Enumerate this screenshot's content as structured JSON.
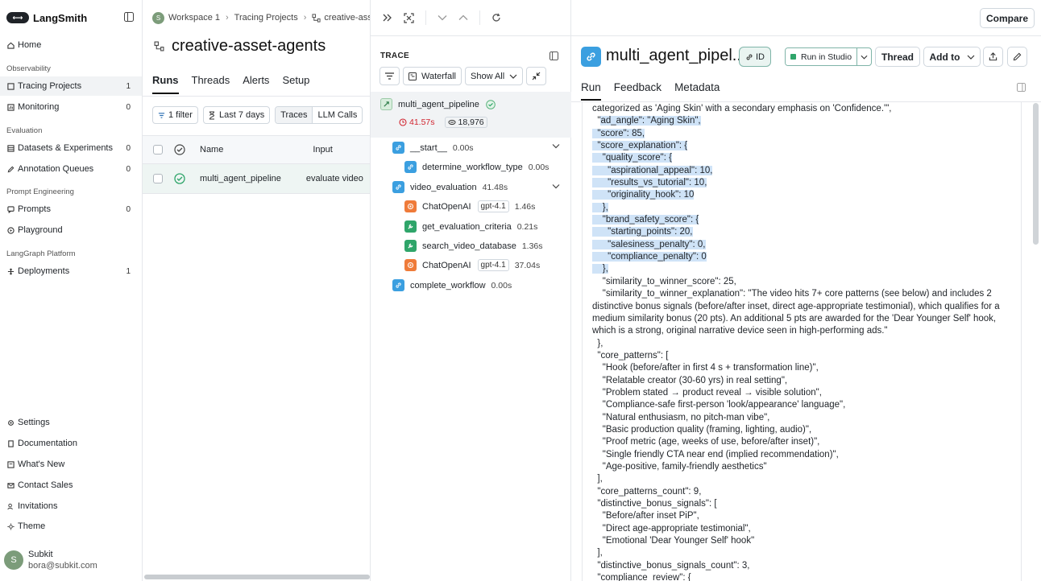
{
  "app": {
    "name": "LangSmith"
  },
  "sidebar": {
    "top_items": [
      {
        "label": "Home",
        "icon": "home-icon"
      }
    ],
    "sections": [
      {
        "title": "Observability",
        "items": [
          {
            "label": "Tracing Projects",
            "count": "1"
          },
          {
            "label": "Monitoring",
            "count": "0"
          }
        ]
      },
      {
        "title": "Evaluation",
        "items": [
          {
            "label": "Datasets & Experiments",
            "count": "0"
          },
          {
            "label": "Annotation Queues",
            "count": "0"
          }
        ]
      },
      {
        "title": "Prompt Engineering",
        "items": [
          {
            "label": "Prompts",
            "count": "0"
          },
          {
            "label": "Playground",
            "count": ""
          }
        ]
      },
      {
        "title": "LangGraph Platform",
        "items": [
          {
            "label": "Deployments",
            "count": "1"
          }
        ]
      }
    ],
    "bottom_items": [
      {
        "label": "Settings"
      },
      {
        "label": "Documentation"
      },
      {
        "label": "What's New"
      },
      {
        "label": "Contact Sales"
      },
      {
        "label": "Invitations"
      },
      {
        "label": "Theme"
      }
    ],
    "user": {
      "initial": "S",
      "name": "Subkit",
      "email": "bora@subkit.com"
    }
  },
  "breadcrumb": {
    "workspace_initial": "S",
    "workspace": "Workspace 1",
    "projects": "Tracing Projects",
    "project": "creative-asse"
  },
  "project": {
    "title": "creative-asset-agents",
    "tabs": [
      "Runs",
      "Threads",
      "Alerts",
      "Setup"
    ]
  },
  "filters": {
    "filter": "1 filter",
    "range": "Last 7 days",
    "segments": [
      "Traces",
      "LLM Calls"
    ]
  },
  "table": {
    "columns": [
      "Name",
      "Input"
    ],
    "rows": [
      {
        "name": "multi_agent_pipeline",
        "input": "evaluate video"
      }
    ]
  },
  "trace": {
    "label": "TRACE",
    "view": "Waterfall",
    "show": "Show All",
    "root": {
      "name": "multi_agent_pipeline",
      "latency": "41.57s",
      "tokens": "18,976"
    },
    "nodes": [
      {
        "name": "__start__",
        "duration": "0.00s",
        "type": "chain",
        "model": ""
      },
      {
        "name": "determine_workflow_type",
        "duration": "0.00s",
        "type": "chain",
        "model": ""
      },
      {
        "name": "video_evaluation",
        "duration": "41.48s",
        "type": "chain",
        "model": ""
      },
      {
        "name": "ChatOpenAI",
        "duration": "1.46s",
        "type": "llm",
        "model": "gpt-4.1"
      },
      {
        "name": "get_evaluation_criteria",
        "duration": "0.21s",
        "type": "tool",
        "model": ""
      },
      {
        "name": "search_video_database",
        "duration": "1.36s",
        "type": "tool",
        "model": ""
      },
      {
        "name": "ChatOpenAI",
        "duration": "37.04s",
        "type": "llm",
        "model": "gpt-4.1"
      },
      {
        "name": "complete_workflow",
        "duration": "0.00s",
        "type": "chain",
        "model": ""
      }
    ]
  },
  "detail": {
    "compare": "Compare",
    "run_title": "multi_agent_pipel...",
    "id_label": "ID",
    "run_in_studio": "Run in Studio",
    "thread": "Thread",
    "add_to": "Add to",
    "tabs": [
      "Run",
      "Feedback",
      "Metadata"
    ],
    "code_lines": [
      {
        "t": "categorized as 'Aging Skin' with a secondary emphasis on 'Confidence.'\",",
        "h": 0
      },
      {
        "t": "  \"",
        "h": 0,
        "s": "ad_angle\": \"Aging Skin\","
      },
      {
        "t": "",
        "h": 1,
        "s": "  \"score\": 85,"
      },
      {
        "t": "",
        "h": 1,
        "s": "  \"score_explanation\": {"
      },
      {
        "t": "",
        "h": 1,
        "s": "    \"quality_score\": {"
      },
      {
        "t": "",
        "h": 1,
        "s": "      \"aspirational_appeal\": 10,"
      },
      {
        "t": "",
        "h": 1,
        "s": "      \"results_vs_tutorial\": 10,"
      },
      {
        "t": "",
        "h": 1,
        "s": "      \"originality_hook\": 10"
      },
      {
        "t": "",
        "h": 1,
        "s": "    },"
      },
      {
        "t": "",
        "h": 1,
        "s": "    \"brand_safety_score\": {"
      },
      {
        "t": "",
        "h": 1,
        "s": "      \"starting_points\": 20,"
      },
      {
        "t": "",
        "h": 1,
        "s": "      \"salesiness_penalty\": 0,"
      },
      {
        "t": "",
        "h": 1,
        "s": "      \"compliance_penalty\": 0"
      },
      {
        "t": "",
        "h": 1,
        "s": "    },"
      },
      {
        "t": "    \"similarity_to_winner_score\": 25,",
        "h": 0
      },
      {
        "t": "    \"similarity_to_winner_explanation\": \"The video hits 7+ core patterns (see below) and includes 2",
        "h": 0
      },
      {
        "t": "distinctive bonus signals (before/after inset, direct age-appropriate testimonial), which qualifies for a",
        "h": 0
      },
      {
        "t": "medium similarity bonus (20 pts). An additional 5 pts are awarded for the 'Dear Younger Self' hook,",
        "h": 0
      },
      {
        "t": "which is a strong, original narrative device seen in high-performing ads.\"",
        "h": 0
      },
      {
        "t": "  },",
        "h": 0
      },
      {
        "t": "  \"core_patterns\": [",
        "h": 0
      },
      {
        "t": "    \"Hook (before/after in first 4 s + transformation line)\",",
        "h": 0
      },
      {
        "t": "    \"Relatable creator (30-60 yrs) in real setting\",",
        "h": 0
      },
      {
        "t": "    \"Problem stated → product reveal → visible solution\",",
        "h": 0
      },
      {
        "t": "    \"Compliance-safe first-person 'look/appearance' language\",",
        "h": 0
      },
      {
        "t": "    \"Natural enthusiasm, no pitch-man vibe\",",
        "h": 0
      },
      {
        "t": "    \"Basic production quality (framing, lighting, audio)\",",
        "h": 0
      },
      {
        "t": "    \"Proof metric (age, weeks of use, before/after inset)\",",
        "h": 0
      },
      {
        "t": "    \"Single friendly CTA near end (implied recommendation)\",",
        "h": 0
      },
      {
        "t": "    \"Age-positive, family-friendly aesthetics\"",
        "h": 0
      },
      {
        "t": "  ],",
        "h": 0
      },
      {
        "t": "  \"core_patterns_count\": 9,",
        "h": 0
      },
      {
        "t": "  \"distinctive_bonus_signals\": [",
        "h": 0
      },
      {
        "t": "    \"Before/after inset PiP\",",
        "h": 0
      },
      {
        "t": "    \"Direct age-appropriate testimonial\",",
        "h": 0
      },
      {
        "t": "    \"Emotional 'Dear Younger Self' hook\"",
        "h": 0
      },
      {
        "t": "  ],",
        "h": 0
      },
      {
        "t": "  \"distinctive_bonus_signals_count\": 3,",
        "h": 0
      },
      {
        "t": "  \"compliance_review\": {",
        "h": 0
      }
    ]
  },
  "colors": {
    "accent": "#3b9fe0",
    "llm": "#ef7b3a",
    "tool": "#2fa56a",
    "selection": "#cfe3f7",
    "error": "#d1242f"
  }
}
